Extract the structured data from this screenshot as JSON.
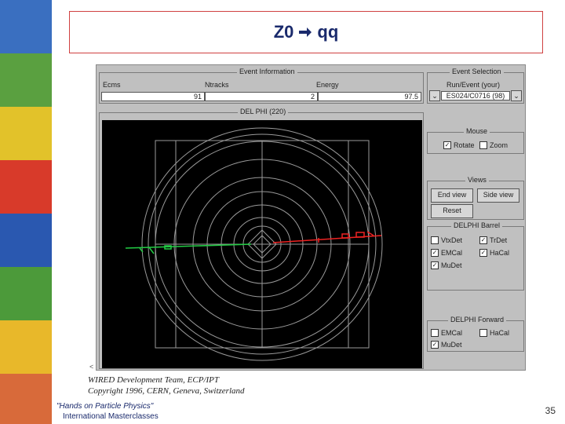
{
  "slide": {
    "title_left": "Z0",
    "title_right": "qq",
    "page_number": "35"
  },
  "event_information": {
    "title": "Event Information",
    "columns": [
      "Ecms",
      "Ntracks",
      "Energy"
    ],
    "values": [
      "91",
      "2",
      "97.5"
    ]
  },
  "event_selection": {
    "title": "Event Selection",
    "label": "Run/Event (your)",
    "value": "ES024/C0716 (98)"
  },
  "view_panel": {
    "title": "DEL PHI (220)"
  },
  "mouse": {
    "title": "Mouse",
    "rotate_label": "Rotate",
    "rotate_checked": true,
    "zoom_label": "Zoom",
    "zoom_checked": false
  },
  "views": {
    "title": "Views",
    "end_view": "End view",
    "side_view": "Side view",
    "reset": "Reset"
  },
  "delphi_barrel": {
    "title": "DELPHI Barrel",
    "items": [
      {
        "label": "VtxDet",
        "checked": false
      },
      {
        "label": "TrDet",
        "checked": true
      },
      {
        "label": "EMCal",
        "checked": true
      },
      {
        "label": "HaCal",
        "checked": true
      },
      {
        "label": "MuDet",
        "checked": true
      }
    ]
  },
  "delphi_forward": {
    "title": "DELPHI Forward",
    "items": [
      {
        "label": "EMCal",
        "checked": false
      },
      {
        "label": "HaCal",
        "checked": false
      },
      {
        "label": "MuDet",
        "checked": true
      }
    ]
  },
  "footer": {
    "credit_line1": "WIRED Development Team, ECP/IPT",
    "credit_line2": "Copyright 1996, CERN, Geneva, Switzerland",
    "brand_line1": "\"Hands on Particle Physics\"",
    "brand_line2": "International Masterclasses"
  },
  "colors": {
    "title": "#1a2a6c",
    "track_green": "#22cc44",
    "track_red": "#ee2222"
  }
}
